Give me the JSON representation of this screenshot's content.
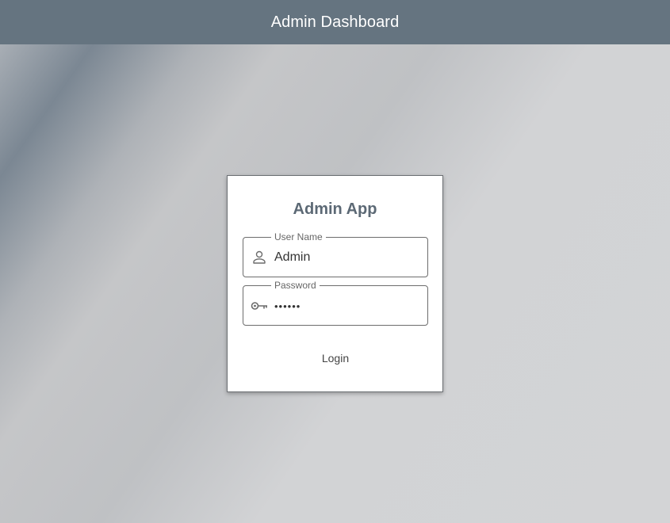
{
  "app_bar": {
    "title": "Admin Dashboard",
    "color": "#657480"
  },
  "login_card": {
    "title": "Admin App",
    "username": {
      "label": "User Name",
      "value": "Admin",
      "icon": "person-icon"
    },
    "password": {
      "label": "Password",
      "value": "••••••",
      "icon": "key-icon"
    },
    "login_label": "Login"
  }
}
